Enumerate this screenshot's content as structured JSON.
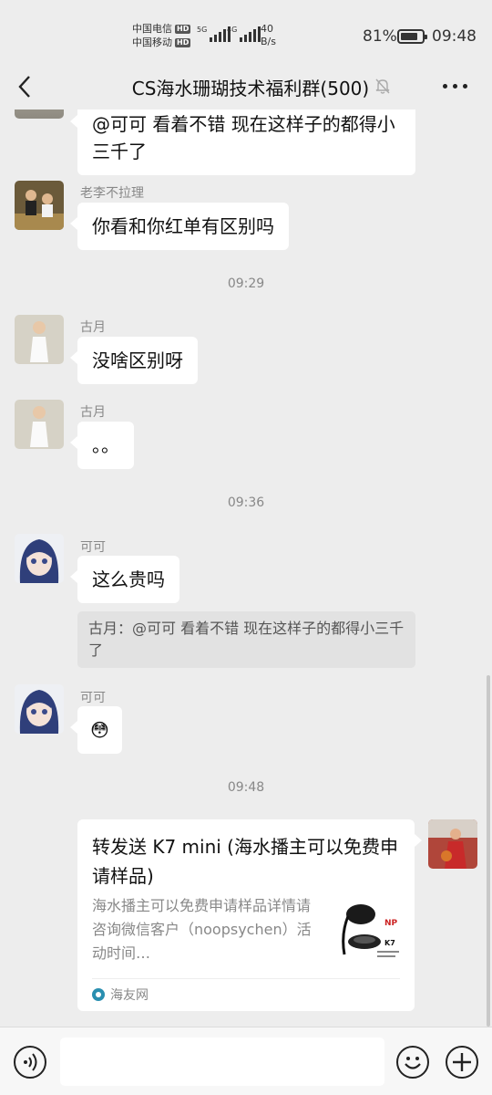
{
  "status_bar": {
    "carrier1": "中国电信",
    "carrier2": "中国移动",
    "hd_badge": "HD",
    "sig1_tag": "5G",
    "sig2_tag": "4G",
    "net_speed_value": "40",
    "net_speed_unit": "B/s",
    "battery_percent": "81%",
    "battery_level": 0.81,
    "time": "09:48"
  },
  "header": {
    "title": "CS海水珊瑚技术福利群(500)",
    "back_icon": "chevron-left-icon",
    "mute_icon": "bell-off-icon",
    "more_icon": "more-horizontal-icon"
  },
  "messages": {
    "m0_text": "@可可 看着不错 现在这样子的都得小三千了",
    "m1_sender": "老李不拉理",
    "m1_text": "你看和你红单有区别吗",
    "ts1": "09:29",
    "m2_sender": "古月",
    "m2_text": "没啥区别呀",
    "m3_sender": "古月",
    "m3_text": "。。",
    "ts2": "09:36",
    "m4_sender": "可可",
    "m4_text": "这么贵吗",
    "m4_quote": "古月：@可可 看着不错 现在这样子的都得小三千了",
    "m5_sender": "可可",
    "m5_text": "😳",
    "ts3": "09:48"
  },
  "link_card": {
    "title": "转发送 K7 mini (海水播主可以免费申请样品)",
    "description": "海水播主可以免费申请样品详情请咨询微信客户（noopsychen）活动时间…",
    "source": "海友网",
    "thumb_brand": "K7",
    "thumb_logo": "NP"
  },
  "input_bar": {
    "voice_icon": "voice-icon",
    "emoji_icon": "smile-icon",
    "plus_icon": "plus-circle-icon",
    "placeholder": ""
  }
}
